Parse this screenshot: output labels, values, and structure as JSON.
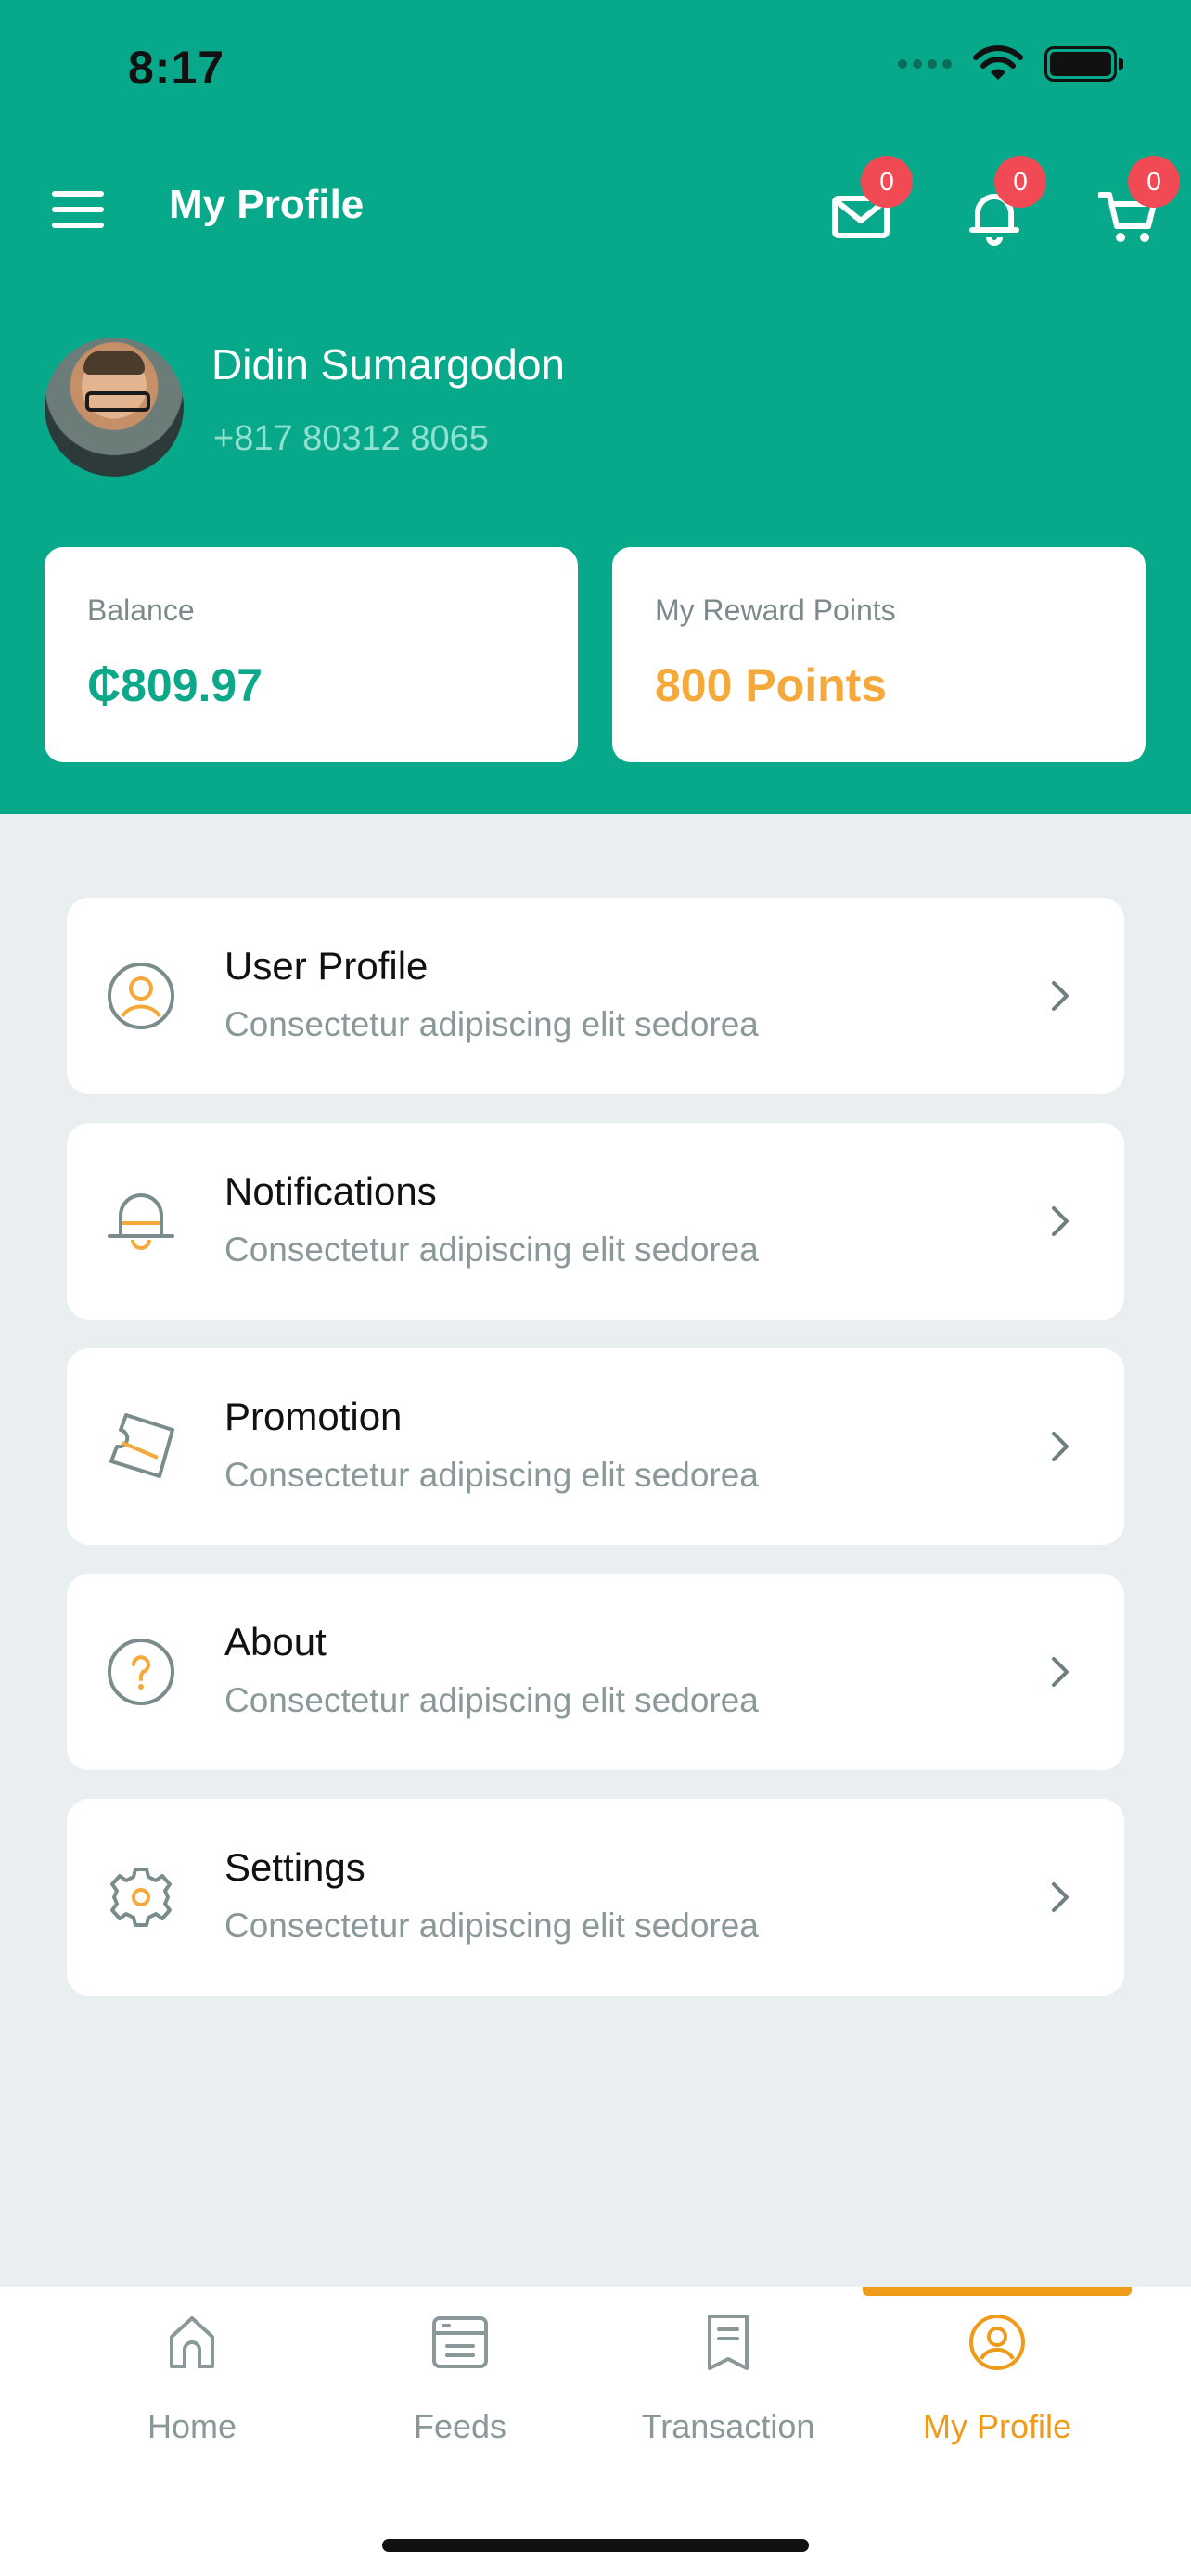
{
  "status_bar": {
    "time": "8:17"
  },
  "appbar": {
    "title": "My Profile",
    "badges": {
      "mail": "0",
      "bell": "0",
      "cart": "0"
    }
  },
  "profile": {
    "name": "Didin Sumargodon",
    "phone": "+817 80312 8065"
  },
  "stats": {
    "balance_label": "Balance",
    "balance_value": "₵809.97",
    "reward_label": "My Reward Points",
    "reward_value": "800 Points"
  },
  "menu": {
    "items": [
      {
        "title": "User Profile",
        "subtitle": "Consectetur adipiscing elit sedorea",
        "icon": "user-circle-icon"
      },
      {
        "title": "Notifications",
        "subtitle": "Consectetur adipiscing elit sedorea",
        "icon": "bell-icon"
      },
      {
        "title": "Promotion",
        "subtitle": "Consectetur adipiscing elit sedorea",
        "icon": "ticket-icon"
      },
      {
        "title": "About",
        "subtitle": "Consectetur adipiscing elit sedorea",
        "icon": "question-circle-icon"
      },
      {
        "title": "Settings",
        "subtitle": "Consectetur adipiscing elit sedorea",
        "icon": "gear-icon"
      }
    ]
  },
  "bottom_nav": {
    "items": [
      {
        "label": "Home",
        "icon": "home-icon"
      },
      {
        "label": "Feeds",
        "icon": "feeds-icon"
      },
      {
        "label": "Transaction",
        "icon": "receipt-icon"
      },
      {
        "label": "My Profile",
        "icon": "user-circle-icon"
      }
    ],
    "active": "My Profile"
  },
  "colors": {
    "primary": "#08A88A",
    "accent": "#F09A1A",
    "reward": "#F6A93B",
    "badge": "#F24A54",
    "background": "#E9EEF1"
  }
}
